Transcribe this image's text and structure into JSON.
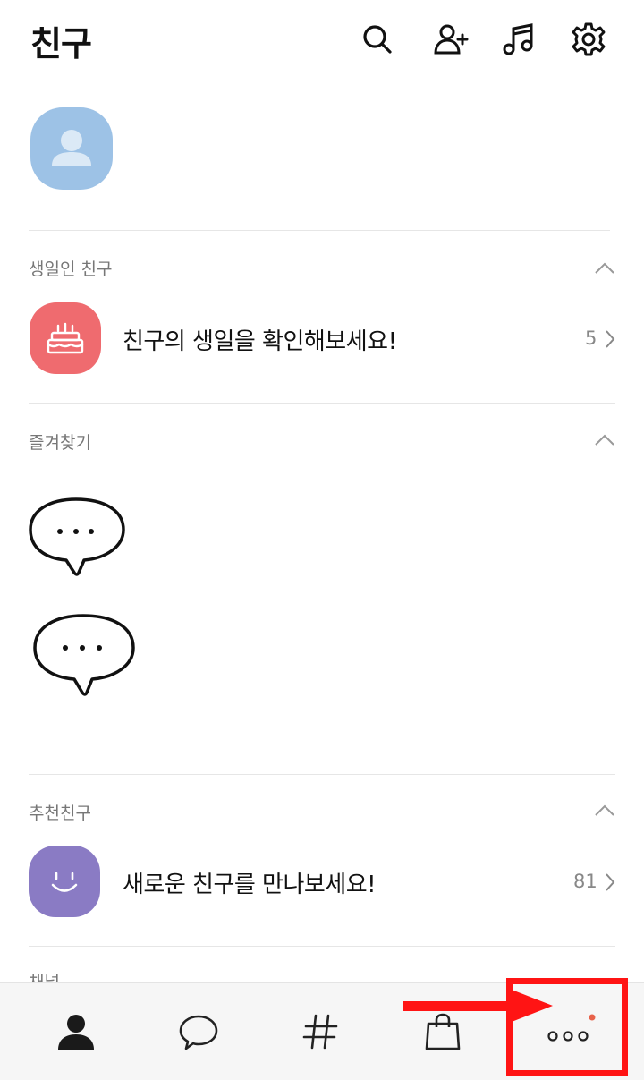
{
  "header": {
    "title": "친구",
    "icons": [
      "search-icon",
      "add-friend-icon",
      "music-icon",
      "settings-icon"
    ]
  },
  "profile": {
    "avatar_color": "#9dc2e6"
  },
  "birthday": {
    "section_label": "생일인 친구",
    "row_text": "친구의 생일을 확인해보세요!",
    "count": "5",
    "tile_color": "#ef6b6f"
  },
  "favorites": {
    "section_label": "즐겨찾기"
  },
  "recommended": {
    "section_label": "추천친구",
    "row_text": "새로운 친구를 만나보세요!",
    "count": "81",
    "tile_color": "#8a7bc4"
  },
  "channel": {
    "section_label": "채널"
  },
  "tabbar": {
    "tabs": [
      "friends-tab",
      "chats-tab",
      "open-chat-tab",
      "shopping-tab",
      "more-tab"
    ],
    "more_badge_color": "#e8624a"
  },
  "annotation": {
    "highlight_color": "#ff1414"
  }
}
